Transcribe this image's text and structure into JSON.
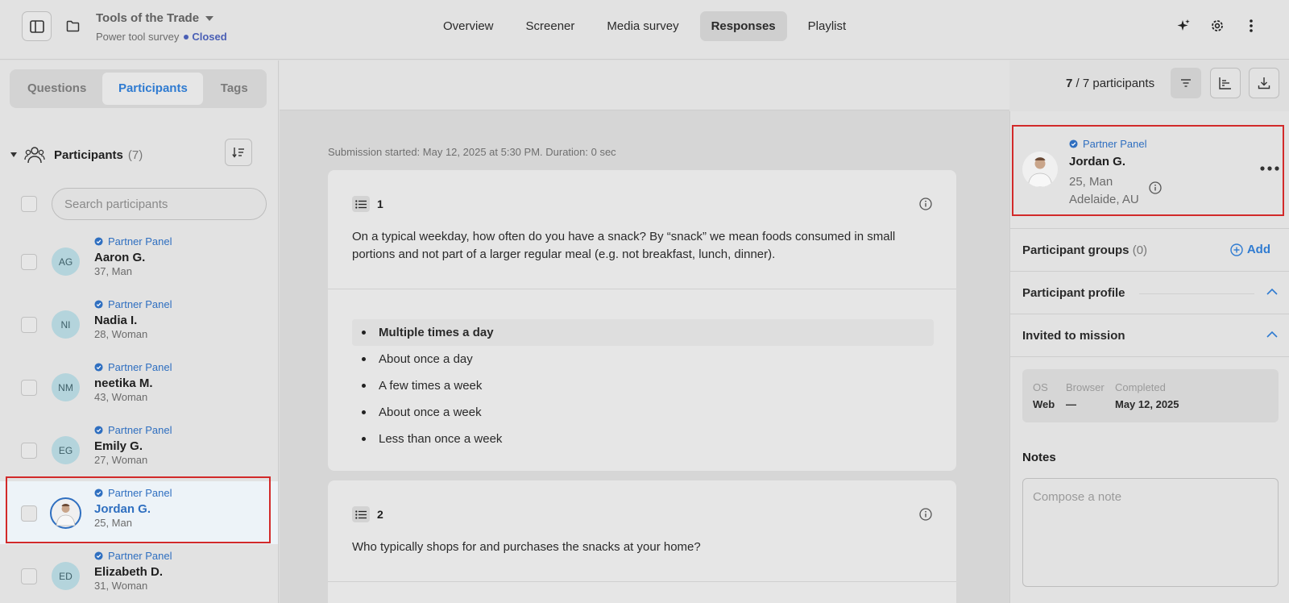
{
  "header": {
    "project_title": "Tools of the Trade",
    "project_subtitle": "Power tool survey",
    "status": "Closed",
    "nav_tabs": [
      "Overview",
      "Screener",
      "Media survey",
      "Responses",
      "Playlist"
    ],
    "active_tab": "Responses"
  },
  "left": {
    "segments": [
      "Questions",
      "Participants",
      "Tags"
    ],
    "active_segment": "Participants",
    "participants_title": "Participants",
    "participants_count": "(7)",
    "search_placeholder": "Search participants",
    "participants": [
      {
        "initials": "AG",
        "panel": "Partner Panel",
        "name": "Aaron G.",
        "meta": "37, Man"
      },
      {
        "initials": "NI",
        "panel": "Partner Panel",
        "name": "Nadia I.",
        "meta": "28, Woman"
      },
      {
        "initials": "NM",
        "panel": "Partner Panel",
        "name": "neetika M.",
        "meta": "43, Woman"
      },
      {
        "initials": "EG",
        "panel": "Partner Panel",
        "name": "Emily G.",
        "meta": "27, Woman"
      },
      {
        "initials": "",
        "panel": "Partner Panel",
        "name": "Jordan G.",
        "meta": "25, Man",
        "selected": true
      },
      {
        "initials": "ED",
        "panel": "Partner Panel",
        "name": "Elizabeth D.",
        "meta": "31, Woman"
      }
    ]
  },
  "toolbar": {
    "count_shown": "7",
    "count_total": "/ 7 participants"
  },
  "main": {
    "submission": "Submission started: May 12, 2025 at 5:30 PM. Duration: 0 sec",
    "questions": [
      {
        "number": "1",
        "text": "On a typical weekday, how often do you have a snack? By “snack” we mean foods consumed in small portions and not part of a larger regular meal (e.g. not breakfast, lunch, dinner).",
        "answers": [
          "Multiple times a day",
          "About once a day",
          "A few times a week",
          "About once a week",
          "Less than once a week"
        ],
        "selected_answer": "Multiple times a day"
      },
      {
        "number": "2",
        "text": "Who typically shops for and purchases the snacks at your home?"
      }
    ]
  },
  "right": {
    "panel": "Partner Panel",
    "name": "Jordan G.",
    "age_gender": "25, Man",
    "location": "Adelaide, AU",
    "groups_title": "Participant groups",
    "groups_count": "(0)",
    "add_label": "Add",
    "profile_title": "Participant profile",
    "invited_title": "Invited to mission",
    "device": {
      "os_label": "OS",
      "os_value": "Web",
      "browser_label": "Browser",
      "browser_value": "—",
      "completed_label": "Completed",
      "completed_value": "May 12, 2025"
    },
    "notes_title": "Notes",
    "notes_placeholder": "Compose a note"
  },
  "colors": {
    "accent": "#2f7bd1",
    "status_closed": "#4a5fb5",
    "highlight": "#d22a2a"
  },
  "icons": [
    "sidebar-toggle-icon",
    "folder-icon",
    "sparkle-icon",
    "gear-icon",
    "kebab-icon",
    "filter-icon",
    "chart-icon",
    "download-icon",
    "people-icon",
    "sort-icon",
    "verified-badge-icon",
    "list-icon",
    "info-icon",
    "more-icon",
    "plus-circle-icon",
    "chevron-up-icon"
  ]
}
